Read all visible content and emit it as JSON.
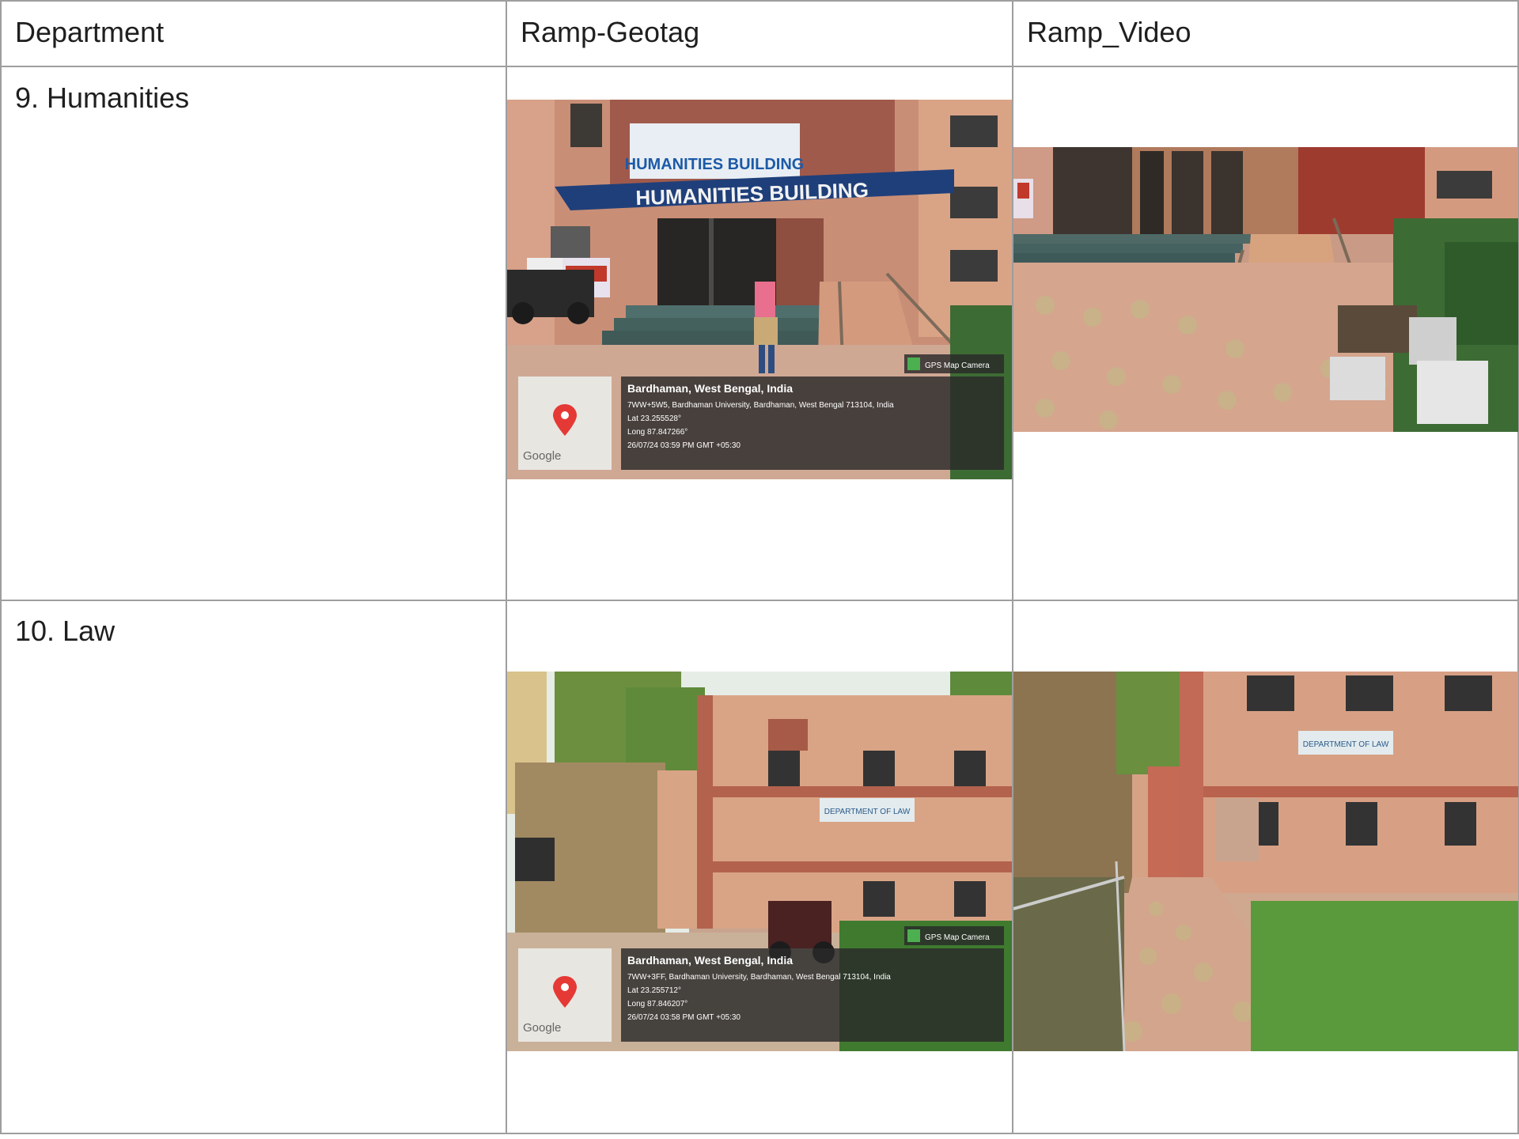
{
  "table": {
    "headers": [
      "Department",
      "Ramp-Geotag",
      "Ramp_Video"
    ],
    "rows": [
      {
        "department": "9. Humanities",
        "geotag_photo": {
          "signs": [
            "HUMANITIES BUILDING",
            "HUMANITIES BUILDING"
          ],
          "app_badge": "GPS Map Camera",
          "map_logo": "Google",
          "location_title": "Bardhaman, West Bengal, India",
          "address": "7WW+5W5, Bardhaman University, Bardhaman, West Bengal 713104, India",
          "lat": "Lat 23.255528°",
          "long": "Long 87.847266°",
          "timestamp": "26/07/24 03:59 PM GMT +05:30"
        },
        "video_photo": {}
      },
      {
        "department": "10. Law",
        "geotag_photo": {
          "signs": [
            "DEPARTMENT OF LAW"
          ],
          "app_badge": "GPS Map Camera",
          "map_logo": "Google",
          "location_title": "Bardhaman, West Bengal, India",
          "address": "7WW+3FF, Bardhaman University, Bardhaman, West Bengal 713104, India",
          "lat": "Lat 23.255712°",
          "long": "Long 87.846207°",
          "timestamp": "26/07/24 03:58 PM GMT +05:30"
        },
        "video_photo": {
          "signs": [
            "DEPARTMENT OF LAW"
          ]
        }
      }
    ]
  },
  "colors": {
    "grid": "#9e9e9e",
    "text": "#1f1f1f",
    "map_pin": "#e53935"
  }
}
